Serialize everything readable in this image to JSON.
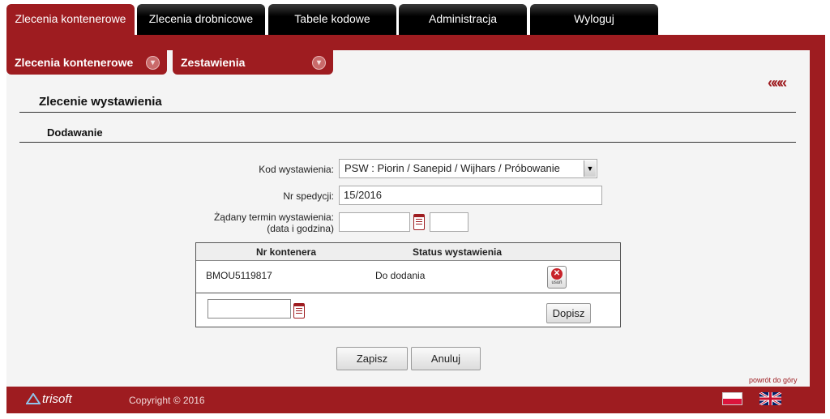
{
  "main_tabs": [
    {
      "label": "Zlecenia kontenerowe"
    },
    {
      "label": "Zlecenia drobnicowe"
    },
    {
      "label": "Tabele kodowe"
    },
    {
      "label": "Administracja"
    },
    {
      "label": "Wyloguj"
    }
  ],
  "sub_tabs": [
    {
      "label": "Zlecenia kontenerowe"
    },
    {
      "label": "Zestawienia"
    }
  ],
  "collapse_glyph": "«««",
  "page_title": "Zlecenie wystawienia",
  "section_title": "Dodawanie",
  "form": {
    "kod_label": "Kod wystawienia:",
    "kod_value": "PSW : Piorin / Sanepid / Wijhars / Próbowanie",
    "nr_label": "Nr spedycji:",
    "nr_value": "15/2016",
    "termin_label_line1": "Żądany termin wystawienia:",
    "termin_label_line2": "(data i godzina)",
    "termin_date": "",
    "termin_time": ""
  },
  "table": {
    "headers": [
      "Nr kontenera",
      "Status wystawienia"
    ],
    "rows": [
      {
        "container": "BMOU5119817",
        "status": "Do dodania",
        "delete_label": "usuń"
      }
    ],
    "new_container_value": "",
    "add_button": "Dopisz"
  },
  "buttons": {
    "save": "Zapisz",
    "cancel": "Anuluj"
  },
  "back_to_top": "powrót do góry",
  "footer": {
    "logo_text": "trisoft",
    "copyright": "Copyright © 2016"
  },
  "colors": {
    "brand": "#9e1c20",
    "tab_dark": "#000000",
    "content_bg": "#f4f4f4"
  }
}
